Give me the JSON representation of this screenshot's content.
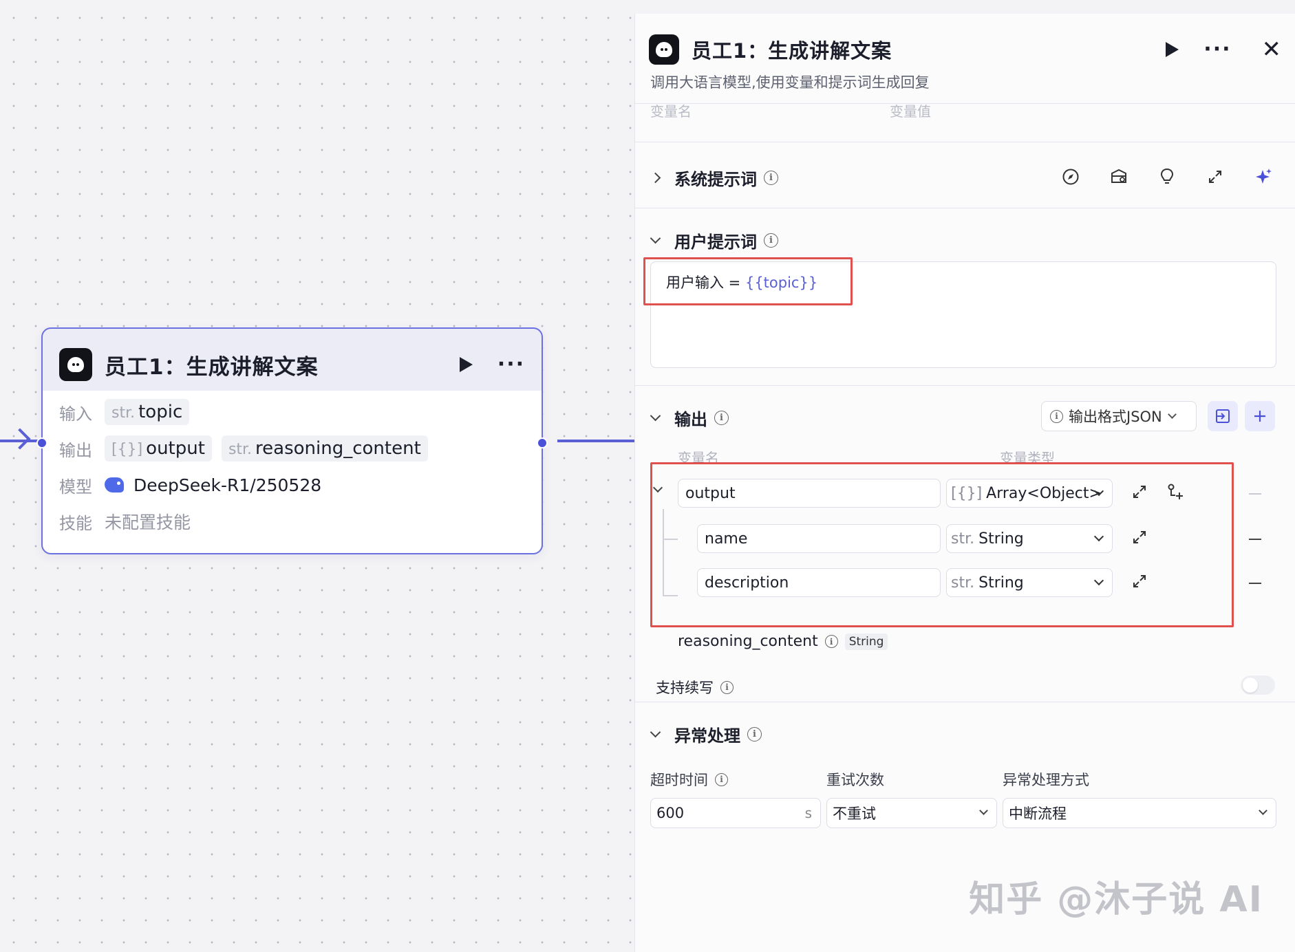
{
  "node": {
    "title": "员工1：生成讲解文案",
    "more": "···",
    "input_label": "输入",
    "input_chip": {
      "type": "str.",
      "name": "topic"
    },
    "output_label": "输出",
    "output_chips": [
      {
        "type": "[{}]",
        "name": "output"
      },
      {
        "type": "str.",
        "name": "reasoning_content"
      }
    ],
    "model_label": "模型",
    "model_value": "DeepSeek-R1/250528",
    "skills_label": "技能",
    "skills_value": "未配置技能"
  },
  "panel": {
    "title": "员工1：生成讲解文案",
    "description": "调用大语言模型,使用变量和提示词生成回复",
    "more": "···",
    "close": "✕",
    "faded_col_name": "变量名",
    "faded_col_value": "变量值",
    "system_prompt": {
      "title": "系统提示词",
      "icons": [
        "compass-icon",
        "prompt-library-icon",
        "lightbulb-icon",
        "expand-icon",
        "sparkle-icon"
      ]
    },
    "user_prompt": {
      "title": "用户提示词",
      "text_prefix": "用户输入 = ",
      "text_var": "{{topic}}"
    },
    "output": {
      "title": "输出",
      "format_select": "输出格式JSON",
      "col_name": "变量名",
      "col_type": "变量类型",
      "rows": [
        {
          "name": "output",
          "type_prefix": "[{}]",
          "type": "Array<Object>"
        },
        {
          "name": "name",
          "type_prefix": "str.",
          "type": "String"
        },
        {
          "name": "description",
          "type_prefix": "str.",
          "type": "String"
        }
      ],
      "reasoning_name": "reasoning_content",
      "reasoning_type": "String",
      "support_continue": "支持续写",
      "support_continue_enabled": false
    },
    "exception": {
      "title": "异常处理",
      "timeout_label": "超时时间",
      "timeout_value": "600",
      "timeout_unit": "s",
      "retry_label": "重试次数",
      "retry_value": "不重试",
      "handling_label": "异常处理方式",
      "handling_value": "中断流程"
    }
  },
  "watermark": "知乎 @沐子说 AI",
  "colors": {
    "accent": "#5a5fd6",
    "highlight_box": "#e0504c",
    "canvas_bg": "#f3f3f6"
  }
}
